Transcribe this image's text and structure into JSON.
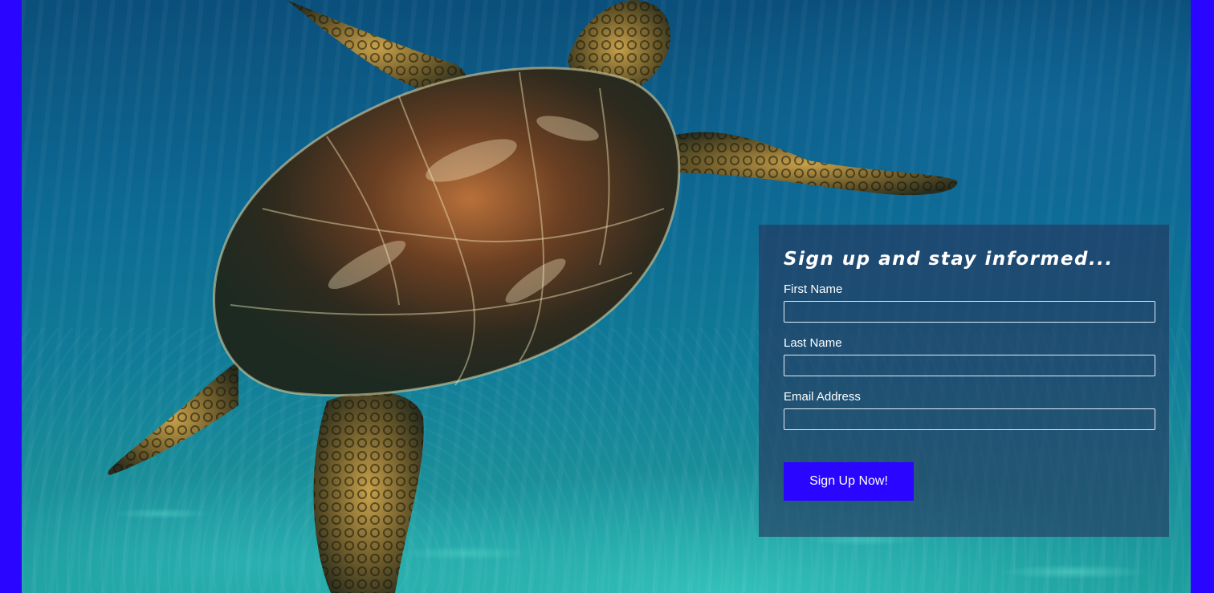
{
  "colors": {
    "accent": "#2a05ff",
    "panel": "#26345c"
  },
  "hero": {
    "image": "sea-turtle-swimming-underwater"
  },
  "form": {
    "heading": "Sign up and stay informed...",
    "fields": [
      {
        "label": "First Name",
        "value": ""
      },
      {
        "label": "Last Name",
        "value": ""
      },
      {
        "label": "Email Address",
        "value": ""
      }
    ],
    "submit_label": "Sign Up Now!"
  }
}
